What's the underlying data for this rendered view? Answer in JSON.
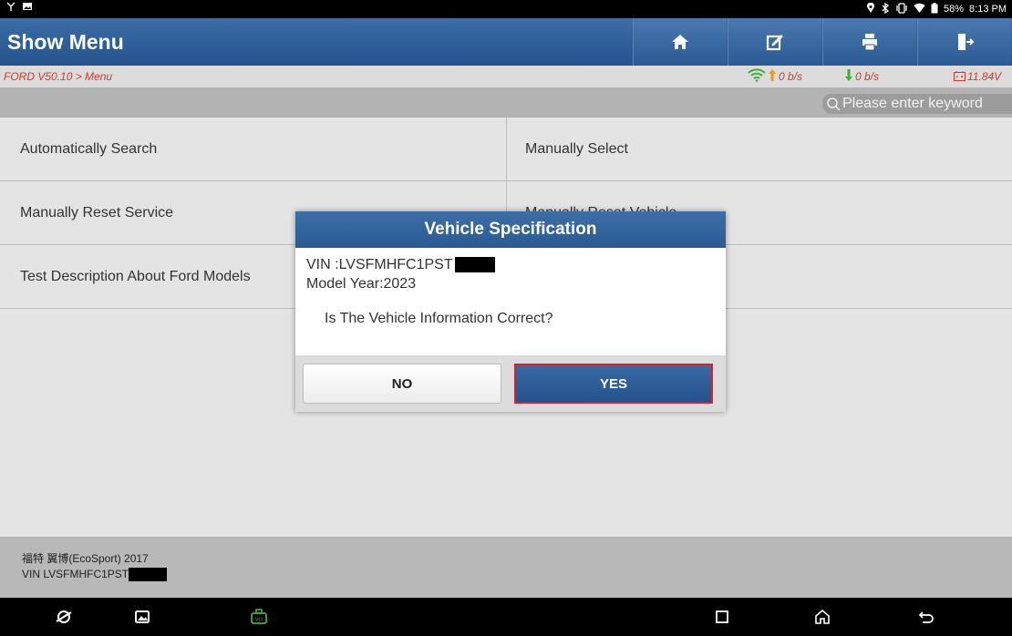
{
  "status_bar": {
    "left_icons": [
      "usb-debug-icon",
      "image-icon"
    ],
    "right_icons": [
      "location-icon",
      "bluetooth-icon",
      "vibrate-icon",
      "wifi-icon",
      "battery-icon"
    ],
    "battery": "58%",
    "time": "8:13 PM"
  },
  "header": {
    "title": "Show Menu",
    "buttons": [
      "home-icon",
      "edit-icon",
      "print-icon",
      "exit-icon"
    ]
  },
  "breadcrumb": {
    "path": "FORD V50.10 > Menu",
    "upload_rate": "0 b/s",
    "download_rate": "0 b/s",
    "voltage": "11.84V"
  },
  "search": {
    "placeholder": "Please enter keyword"
  },
  "menu": {
    "rows": [
      [
        "Automatically Search",
        "Manually Select"
      ],
      [
        "Manually Reset Service",
        "Manually Reset Vehicle"
      ],
      [
        "Test Description About Ford Models",
        ""
      ]
    ]
  },
  "footer": {
    "vehicle": "福特 翼博(EcoSport) 2017",
    "vin_prefix": "VIN LVSFMHFC1PST"
  },
  "dialog": {
    "title": "Vehicle Specification",
    "vin_label": "VIN :LVSFMHFC1PST",
    "model_year": "Model Year:2023",
    "question": "Is The Vehicle Information Correct?",
    "no_label": "NO",
    "yes_label": "YES"
  },
  "colors": {
    "header_blue": "#2c5b94",
    "breadcrumb_red": "#d23a2b",
    "highlight_red": "#d9222b",
    "vci_green": "#3fae3a"
  }
}
